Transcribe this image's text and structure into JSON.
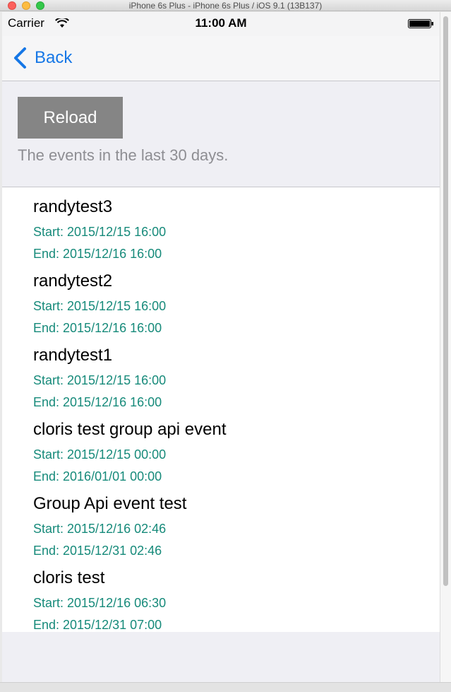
{
  "window": {
    "title": "iPhone 6s Plus - iPhone 6s Plus / iOS 9.1 (13B137)"
  },
  "status_bar": {
    "carrier": "Carrier",
    "time": "11:00 AM",
    "wifi_icon": "wifi-icon",
    "battery_icon": "battery-icon"
  },
  "nav": {
    "back_label": "Back",
    "back_icon": "chevron-left-icon",
    "accent": "#1677e6"
  },
  "header": {
    "reload_label": "Reload",
    "subtitle": "The events in the last 30 days."
  },
  "events": [
    {
      "name": "randytest3",
      "start": "Start: 2015/12/15 16:00",
      "end": "End: 2015/12/16 16:00"
    },
    {
      "name": "randytest2",
      "start": "Start: 2015/12/15 16:00",
      "end": "End: 2015/12/16 16:00"
    },
    {
      "name": "randytest1",
      "start": "Start: 2015/12/15 16:00",
      "end": "End: 2015/12/16 16:00"
    },
    {
      "name": "cloris test group api event",
      "start": "Start: 2015/12/15 00:00",
      "end": "End: 2016/01/01 00:00"
    },
    {
      "name": "Group Api event test",
      "start": "Start: 2015/12/16 02:46",
      "end": "End: 2015/12/31 02:46"
    },
    {
      "name": "cloris test",
      "start": "Start: 2015/12/16 06:30",
      "end": "End: 2015/12/31 07:00"
    }
  ],
  "colors": {
    "event_date": "#168a7a",
    "reload_bg": "#858585"
  }
}
